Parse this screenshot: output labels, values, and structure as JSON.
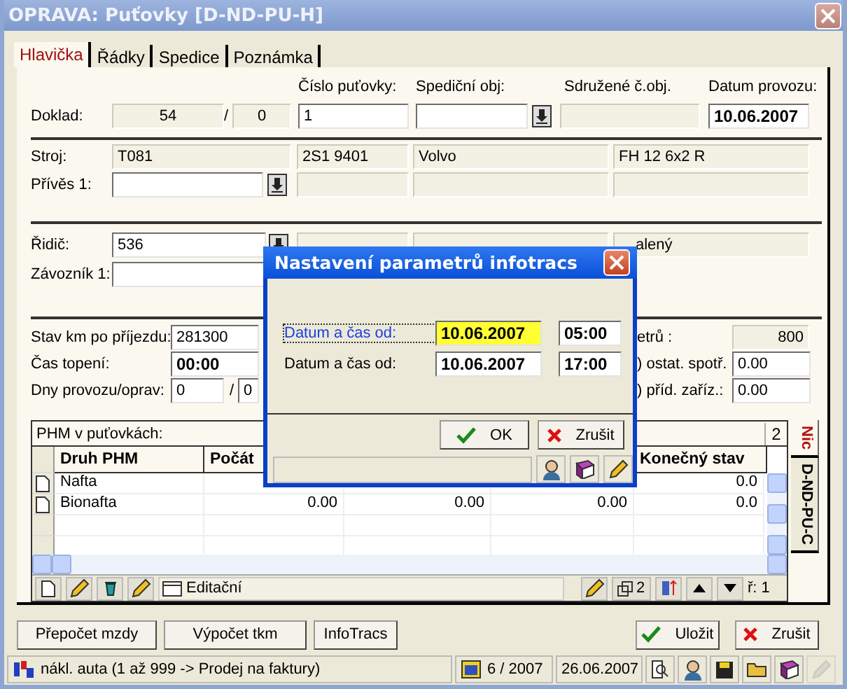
{
  "window": {
    "title": "OPRAVA: Puťovky [D-ND-PU-H]"
  },
  "tabs": [
    {
      "label": "Hlavička",
      "selected": true
    },
    {
      "label": "Řádky",
      "selected": false
    },
    {
      "label": "Spedice",
      "selected": false
    },
    {
      "label": "Poznámka",
      "selected": false
    }
  ],
  "header": {
    "columns": [
      "Číslo puťovky:",
      "Spediční obj:",
      "Sdružené č.obj.",
      "Datum provozu:"
    ],
    "doklad_label": "Doklad:",
    "doklad_number": "54",
    "doklad_separator": "/",
    "doklad_sub": "0",
    "cislo": "1",
    "datum": "10.06.2007"
  },
  "vehicle": {
    "stroj_label": "Stroj:",
    "stroj": [
      "T081",
      "2S1 9401",
      "Volvo",
      "FH 12 6x2 R"
    ],
    "privez_label": "Přívěs 1:"
  },
  "crew": {
    "ridic_label": "Řidič:",
    "ridic": "536",
    "ridic_info": "alený",
    "zavoznik_label": "Závozník 1:"
  },
  "km": {
    "label": "Stav km po příjezdu:",
    "value": "281300",
    "right_label": "etrů :",
    "right_value": "800"
  },
  "topeni": {
    "label": "Čas topení:",
    "value": "00:00",
    "right_label": ") ostat. spotř.",
    "right_value": "0.00"
  },
  "dny": {
    "label": "Dny provozu/oprav:",
    "value": "0",
    "separator": "/",
    "sub": "0",
    "right_label": ") příd. zaříz.:",
    "right_value": "0.00"
  },
  "grid": {
    "caption": "PHM v puťovkách:",
    "count": "2",
    "columns": [
      {
        "kind": "text",
        "column_1": "Druh PHM"
      },
      {
        "kind": "number",
        "label": "Počát"
      },
      {
        "kind": "number"
      },
      {
        "kind": "number"
      },
      {
        "kind": "number",
        "label": "Konečný stav"
      }
    ],
    "rows": [
      {
        "column_1": "Nafta",
        "column_5": "0.0"
      },
      {
        "column_1": "Bionafta",
        "column_2": "0.00",
        "column_3": "0.00",
        "column_4": "0.00",
        "column_5": "0.0"
      }
    ]
  },
  "toolbar": {
    "mode": "Editační",
    "copies": "2",
    "row": "ř: 1"
  },
  "side_tabs": [
    {
      "label": "Nic",
      "selected": true
    },
    {
      "label": "D-ND-PU-C",
      "selected": false
    }
  ],
  "actions": [
    "Přepočet mzdy",
    "Výpočet tkm",
    "InfoTracs"
  ],
  "confirm": [
    {
      "label": "Uložit",
      "kind": "ok"
    },
    {
      "label": "Zrušit",
      "kind": "cancel"
    }
  ],
  "status_bar": {
    "message": "nákl. auta (1 až 999 -> Prodej na faktury)",
    "period": "6 / 2007",
    "date": "26.06.2007"
  },
  "dialog": {
    "title": "Nastavení parametrů infotracs",
    "rows": [
      {
        "label": "Datum a čas od:",
        "date": "10.06.2007",
        "time": "05:00",
        "focused": true
      },
      {
        "label": "Datum a čas od:",
        "date": "10.06.2007",
        "time": "17:00",
        "focused": false
      }
    ],
    "buttons": [
      {
        "label": "OK",
        "kind": "ok"
      },
      {
        "label": "Zrušit",
        "kind": "cancel"
      }
    ]
  }
}
